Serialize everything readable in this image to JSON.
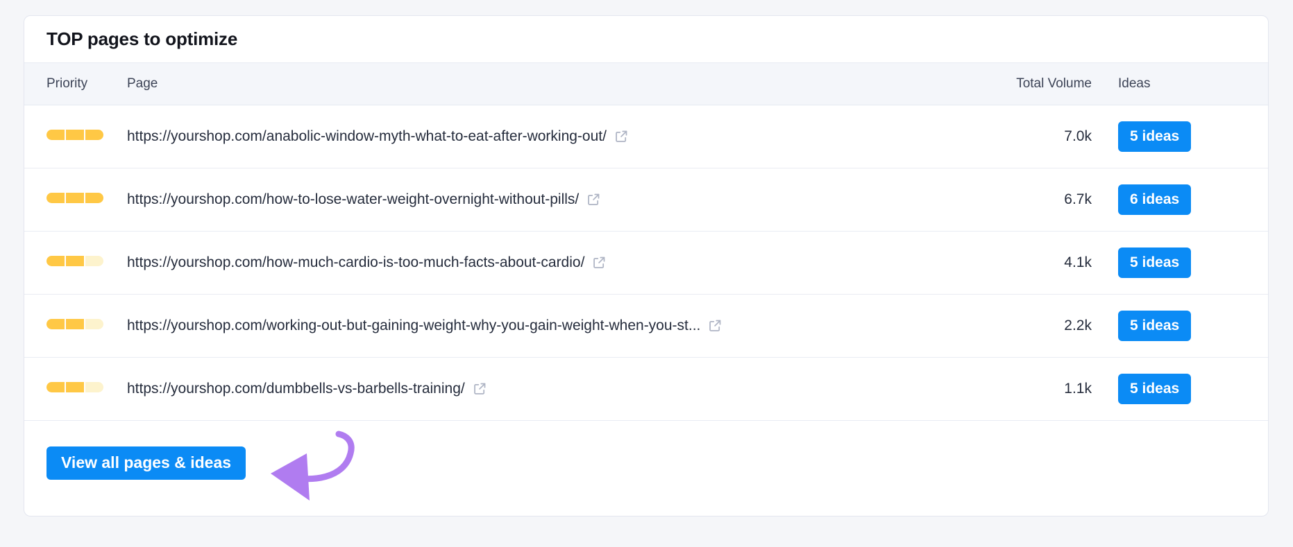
{
  "card": {
    "title": "TOP pages to optimize"
  },
  "table": {
    "columns": {
      "priority": "Priority",
      "page": "Page",
      "volume": "Total Volume",
      "ideas": "Ideas"
    },
    "rows": [
      {
        "priority_filled": 3,
        "priority_total": 3,
        "url": "https://yourshop.com/anabolic-window-myth-what-to-eat-after-working-out/",
        "external_icon": "external-link-icon",
        "volume": "7.0k",
        "ideas": "5 ideas"
      },
      {
        "priority_filled": 3,
        "priority_total": 3,
        "url": "https://yourshop.com/how-to-lose-water-weight-overnight-without-pills/",
        "external_icon": "external-link-icon",
        "volume": "6.7k",
        "ideas": "6 ideas"
      },
      {
        "priority_filled": 2,
        "priority_total": 3,
        "url": "https://yourshop.com/how-much-cardio-is-too-much-facts-about-cardio/",
        "external_icon": "external-link-icon",
        "volume": "4.1k",
        "ideas": "5 ideas"
      },
      {
        "priority_filled": 2,
        "priority_total": 3,
        "url": "https://yourshop.com/working-out-but-gaining-weight-why-you-gain-weight-when-you-st...",
        "external_icon": "external-link-icon",
        "volume": "2.2k",
        "ideas": "5 ideas"
      },
      {
        "priority_filled": 2,
        "priority_total": 3,
        "url": "https://yourshop.com/dumbbells-vs-barbells-training/",
        "external_icon": "external-link-icon",
        "volume": "1.1k",
        "ideas": "5 ideas"
      }
    ]
  },
  "footer": {
    "view_all_label": "View all pages & ideas"
  },
  "annotation": {
    "type": "curved-arrow",
    "color": "#b07cf0",
    "points_to": "view-all-pages-button"
  },
  "colors": {
    "accent_blue": "#0b8bf5",
    "priority_filled": "#ffc845",
    "priority_empty": "#fdf3cd",
    "header_bg": "#f4f6fa",
    "page_bg": "#f5f6f9",
    "card_bg": "#ffffff",
    "text": "#252c3c",
    "annotation_purple": "#b07cf0"
  }
}
